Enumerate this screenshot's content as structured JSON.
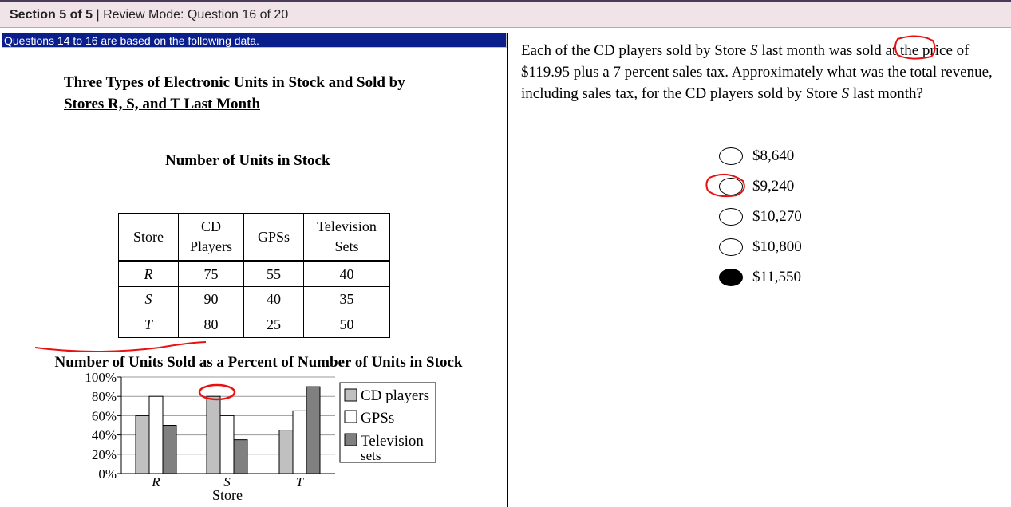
{
  "header": {
    "section": "Section 5 of 5",
    "mode": "| Review Mode: Question 16 of 20"
  },
  "left": {
    "banner": "Questions 14 to 16 are based on the following data.",
    "title_line1": "Three Types of Electronic Units in Stock and Sold by",
    "title_line2": "Stores R, S, and T Last Month",
    "stock_title": "Number of Units in Stock",
    "table": {
      "headers": [
        "Store",
        "CD Players",
        "GPSs",
        "Television Sets"
      ],
      "rows": [
        [
          "R",
          "75",
          "55",
          "40"
        ],
        [
          "S",
          "90",
          "40",
          "35"
        ],
        [
          "T",
          "80",
          "25",
          "50"
        ]
      ]
    },
    "pct_title": "Number of Units Sold as a Percent of Number of Units in Stock"
  },
  "chart_data": {
    "type": "bar",
    "categories": [
      "R",
      "S",
      "T"
    ],
    "xlabel": "Store",
    "ylabel": "",
    "ylim": [
      0,
      100
    ],
    "yticks": [
      "0%",
      "20%",
      "40%",
      "60%",
      "80%",
      "100%"
    ],
    "series": [
      {
        "name": "CD players",
        "values": [
          60,
          80,
          45
        ],
        "color": "#c0c0c0"
      },
      {
        "name": "GPSs",
        "values": [
          80,
          60,
          65
        ],
        "color": "#ffffff"
      },
      {
        "name": "Television sets",
        "values": [
          50,
          35,
          90
        ],
        "color": "#808080"
      }
    ],
    "legend_position": "right",
    "grid": true
  },
  "question": {
    "text_parts": {
      "p1": "Each of the CD players sold by Store ",
      "s1": "S",
      "p2": " last month was sold at the price of $119.95 plus a 7 percent sales tax. Approximately what was the total revenue, including sales tax, for the CD players sold by Store ",
      "s2": "S",
      "p3": " last month?"
    },
    "choices": [
      "$8,640",
      "$9,240",
      "$10,270",
      "$10,800",
      "$11,550"
    ],
    "selected_index": 4
  },
  "colors": {
    "header_bg": "#f0e4e8",
    "banner_bg": "#0a1f8c",
    "annotation": "#e81010"
  }
}
